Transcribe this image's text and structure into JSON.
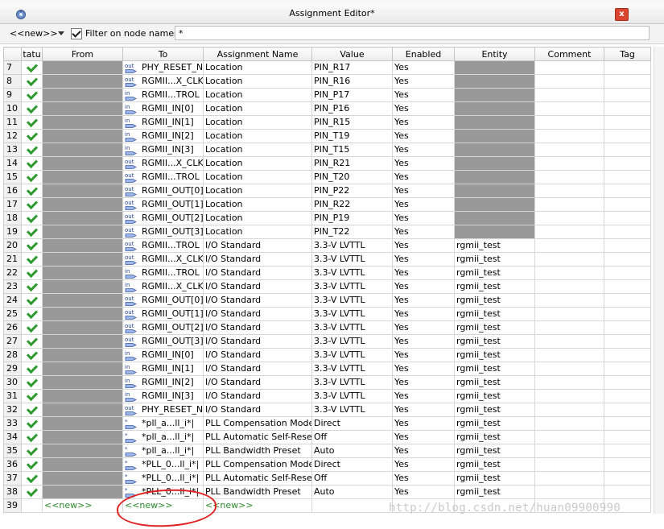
{
  "window": {
    "title": "Assignment Editor*",
    "close_label": "x"
  },
  "filter": {
    "node_select": "<<new>>",
    "filter_label": "Filter on node names:",
    "filter_value": "*"
  },
  "columns": [
    "tatu",
    "From",
    "To",
    "Assignment Name",
    "Value",
    "Enabled",
    "Entity",
    "Comment",
    "Tag"
  ],
  "rows": [
    {
      "n": "7",
      "dir": "out",
      "to": "PHY_RESET_N",
      "name": "Location",
      "value": "PIN_R17",
      "enabled": "Yes",
      "entity": ""
    },
    {
      "n": "8",
      "dir": "out",
      "to": "RGMII...X_CLK",
      "name": "Location",
      "value": "PIN_R16",
      "enabled": "Yes",
      "entity": ""
    },
    {
      "n": "9",
      "dir": "in",
      "to": "RGMII...TROL",
      "name": "Location",
      "value": "PIN_P17",
      "enabled": "Yes",
      "entity": ""
    },
    {
      "n": "10",
      "dir": "in",
      "to": "RGMII_IN[0]",
      "name": "Location",
      "value": "PIN_P16",
      "enabled": "Yes",
      "entity": ""
    },
    {
      "n": "11",
      "dir": "in",
      "to": "RGMII_IN[1]",
      "name": "Location",
      "value": "PIN_R15",
      "enabled": "Yes",
      "entity": ""
    },
    {
      "n": "12",
      "dir": "in",
      "to": "RGMII_IN[2]",
      "name": "Location",
      "value": "PIN_T19",
      "enabled": "Yes",
      "entity": ""
    },
    {
      "n": "13",
      "dir": "in",
      "to": "RGMII_IN[3]",
      "name": "Location",
      "value": "PIN_T15",
      "enabled": "Yes",
      "entity": ""
    },
    {
      "n": "14",
      "dir": "out",
      "to": "RGMII...X_CLK",
      "name": "Location",
      "value": "PIN_R21",
      "enabled": "Yes",
      "entity": ""
    },
    {
      "n": "15",
      "dir": "out",
      "to": "RGMII...TROL",
      "name": "Location",
      "value": "PIN_T20",
      "enabled": "Yes",
      "entity": ""
    },
    {
      "n": "16",
      "dir": "out",
      "to": "RGMII_OUT[0]",
      "name": "Location",
      "value": "PIN_P22",
      "enabled": "Yes",
      "entity": ""
    },
    {
      "n": "17",
      "dir": "out",
      "to": "RGMII_OUT[1]",
      "name": "Location",
      "value": "PIN_R22",
      "enabled": "Yes",
      "entity": ""
    },
    {
      "n": "18",
      "dir": "out",
      "to": "RGMII_OUT[2]",
      "name": "Location",
      "value": "PIN_P19",
      "enabled": "Yes",
      "entity": ""
    },
    {
      "n": "19",
      "dir": "out",
      "to": "RGMII_OUT[3]",
      "name": "Location",
      "value": "PIN_T22",
      "enabled": "Yes",
      "entity": ""
    },
    {
      "n": "20",
      "dir": "out",
      "to": "RGMII...TROL",
      "name": "I/O Standard",
      "value": "3.3-V LVTTL",
      "enabled": "Yes",
      "entity": "rgmii_test"
    },
    {
      "n": "21",
      "dir": "out",
      "to": "RGMII...X_CLK",
      "name": "I/O Standard",
      "value": "3.3-V LVTTL",
      "enabled": "Yes",
      "entity": "rgmii_test"
    },
    {
      "n": "22",
      "dir": "in",
      "to": "RGMII...TROL",
      "name": "I/O Standard",
      "value": "3.3-V LVTTL",
      "enabled": "Yes",
      "entity": "rgmii_test"
    },
    {
      "n": "23",
      "dir": "in",
      "to": "RGMII...X_CLK",
      "name": "I/O Standard",
      "value": "3.3-V LVTTL",
      "enabled": "Yes",
      "entity": "rgmii_test"
    },
    {
      "n": "24",
      "dir": "out",
      "to": "RGMII_OUT[0]",
      "name": "I/O Standard",
      "value": "3.3-V LVTTL",
      "enabled": "Yes",
      "entity": "rgmii_test"
    },
    {
      "n": "25",
      "dir": "out",
      "to": "RGMII_OUT[1]",
      "name": "I/O Standard",
      "value": "3.3-V LVTTL",
      "enabled": "Yes",
      "entity": "rgmii_test"
    },
    {
      "n": "26",
      "dir": "out",
      "to": "RGMII_OUT[2]",
      "name": "I/O Standard",
      "value": "3.3-V LVTTL",
      "enabled": "Yes",
      "entity": "rgmii_test"
    },
    {
      "n": "27",
      "dir": "out",
      "to": "RGMII_OUT[3]",
      "name": "I/O Standard",
      "value": "3.3-V LVTTL",
      "enabled": "Yes",
      "entity": "rgmii_test"
    },
    {
      "n": "28",
      "dir": "in",
      "to": "RGMII_IN[0]",
      "name": "I/O Standard",
      "value": "3.3-V LVTTL",
      "enabled": "Yes",
      "entity": "rgmii_test"
    },
    {
      "n": "29",
      "dir": "in",
      "to": "RGMII_IN[1]",
      "name": "I/O Standard",
      "value": "3.3-V LVTTL",
      "enabled": "Yes",
      "entity": "rgmii_test"
    },
    {
      "n": "30",
      "dir": "in",
      "to": "RGMII_IN[2]",
      "name": "I/O Standard",
      "value": "3.3-V LVTTL",
      "enabled": "Yes",
      "entity": "rgmii_test"
    },
    {
      "n": "31",
      "dir": "in",
      "to": "RGMII_IN[3]",
      "name": "I/O Standard",
      "value": "3.3-V LVTTL",
      "enabled": "Yes",
      "entity": "rgmii_test"
    },
    {
      "n": "32",
      "dir": "out",
      "to": "PHY_RESET_N",
      "name": "I/O Standard",
      "value": "3.3-V LVTTL",
      "enabled": "Yes",
      "entity": "rgmii_test"
    },
    {
      "n": "33",
      "dir": "star",
      "to": "*pll_a...ll_i*|",
      "name": "PLL Compensation Mode",
      "value": "Direct",
      "enabled": "Yes",
      "entity": "rgmii_test"
    },
    {
      "n": "34",
      "dir": "star",
      "to": "*pll_a...ll_i*|",
      "name": "PLL Automatic Self-Reset",
      "value": "Off",
      "enabled": "Yes",
      "entity": "rgmii_test"
    },
    {
      "n": "35",
      "dir": "star",
      "to": "*pll_a...ll_i*|",
      "name": "PLL Bandwidth Preset",
      "value": "Auto",
      "enabled": "Yes",
      "entity": "rgmii_test"
    },
    {
      "n": "36",
      "dir": "star",
      "to": "*PLL_0...ll_i*|",
      "name": "PLL Compensation Mode",
      "value": "Direct",
      "enabled": "Yes",
      "entity": "rgmii_test"
    },
    {
      "n": "37",
      "dir": "star",
      "to": "*PLL_0...ll_i*|",
      "name": "PLL Automatic Self-Reset",
      "value": "Off",
      "enabled": "Yes",
      "entity": "rgmii_test"
    },
    {
      "n": "38",
      "dir": "star",
      "to": "*PLL_0...ll_i*|",
      "name": "PLL Bandwidth Preset",
      "value": "Auto",
      "enabled": "Yes",
      "entity": "rgmii_test"
    }
  ],
  "new_row": {
    "n": "39",
    "from": "<<new>>",
    "to": "<<new>>",
    "name": "<<new>>"
  },
  "icons": {
    "out": "out",
    "in": "in",
    "star": "*"
  },
  "colors": {
    "check": "#2e9a2e",
    "redact": "#999999",
    "new_text": "#2c8a2c",
    "annotation": "#e02020"
  },
  "watermark": "http://blog.csdn.net/huan09900990"
}
